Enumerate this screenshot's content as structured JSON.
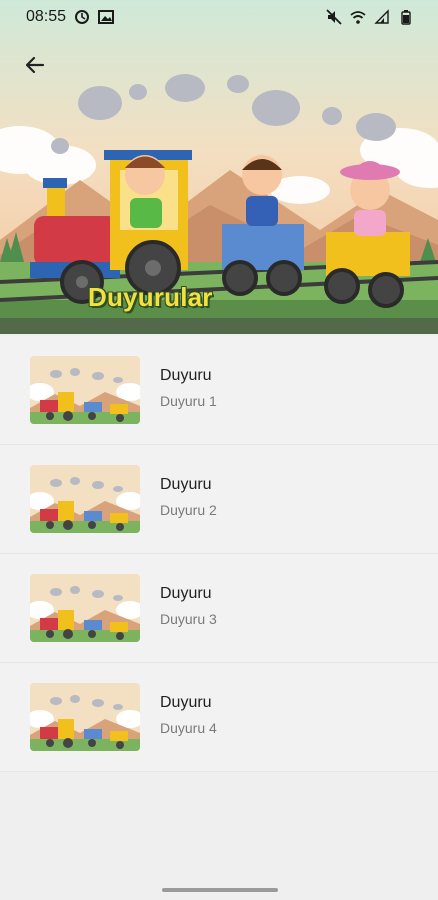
{
  "status_bar": {
    "time": "08:55",
    "left_icons": [
      "sync-icon",
      "image-icon"
    ],
    "right_icons": [
      "mute-icon",
      "wifi-icon",
      "signal-icon",
      "battery-icon"
    ]
  },
  "header": {
    "back_icon": "arrow-left-icon",
    "title": "Duyurular"
  },
  "announcements": [
    {
      "title": "Duyuru",
      "subtitle": "Duyuru 1"
    },
    {
      "title": "Duyuru",
      "subtitle": "Duyuru 2"
    },
    {
      "title": "Duyuru",
      "subtitle": "Duyuru 3"
    },
    {
      "title": "Duyuru",
      "subtitle": "Duyuru 4"
    }
  ]
}
